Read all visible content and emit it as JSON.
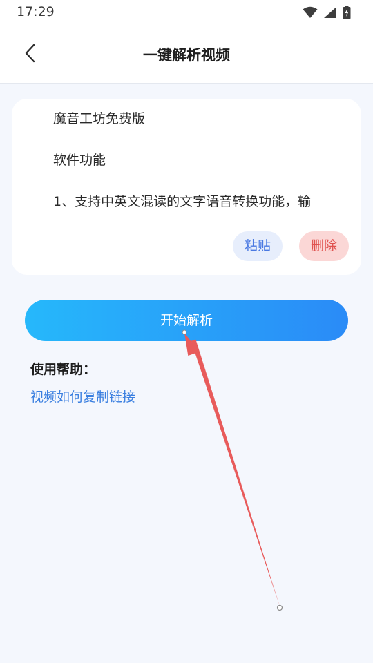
{
  "status_bar": {
    "time": "17:29",
    "icons": [
      "wifi-icon",
      "signal-icon",
      "battery-charging-icon"
    ]
  },
  "header": {
    "back_icon": "chevron-left-icon",
    "title": "一键解析视频"
  },
  "card": {
    "lines": [
      "魔音工坊免费版",
      "软件功能",
      "1、支持中英文混读的文字语音转换功能，输"
    ],
    "paste_label": "粘贴",
    "delete_label": "删除"
  },
  "start_button_label": "开始解析",
  "help": {
    "title": "使用帮助：",
    "link": "视频如何复制链接"
  },
  "colors": {
    "background": "#f4f7fd",
    "accent_gradient_start": "#26b8fb",
    "accent_gradient_end": "#2a8bf7",
    "paste_bg": "#e7eefc",
    "paste_text": "#4a79e2",
    "delete_bg": "#fbd7d6",
    "delete_text": "#e0524f",
    "link": "#3a7fe0",
    "annotation_arrow": "#e85b5b"
  }
}
